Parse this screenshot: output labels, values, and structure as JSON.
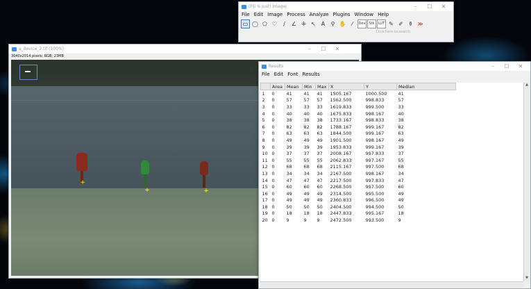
{
  "imagej_window": {
    "title": "(Fiji Is Just) ImageJ",
    "menu": [
      "File",
      "Edit",
      "Image",
      "Process",
      "Analyze",
      "Plugins",
      "Window",
      "Help"
    ],
    "tools": [
      {
        "name": "rectangle-tool-icon",
        "glyph": "▭",
        "active": true
      },
      {
        "name": "oval-tool-icon",
        "glyph": "◯"
      },
      {
        "name": "polygon-tool-icon",
        "glyph": "⬠"
      },
      {
        "name": "freehand-tool-icon",
        "glyph": "♡"
      },
      {
        "name": "line-tool-icon",
        "glyph": "∕"
      },
      {
        "name": "angle-tool-icon",
        "glyph": "∠"
      },
      {
        "name": "point-tool-icon",
        "glyph": "⁜"
      },
      {
        "name": "wand-tool-icon",
        "glyph": "↖"
      },
      {
        "name": "text-tool-icon",
        "glyph": "A"
      },
      {
        "name": "magnifier-tool-icon",
        "glyph": "⚲"
      },
      {
        "name": "hand-tool-icon",
        "glyph": "✋"
      },
      {
        "name": "dropper-tool-icon",
        "glyph": "⁄"
      },
      {
        "name": "dev-tool-icon",
        "glyph": "Dev",
        "box": true
      },
      {
        "name": "stk-tool-icon",
        "glyph": "Stk",
        "box": true
      },
      {
        "name": "lut-tool-icon",
        "glyph": "LUT",
        "box": true
      },
      {
        "name": "brush-tool-icon",
        "glyph": "✎"
      },
      {
        "name": "pencil-tool-icon",
        "glyph": "✐"
      },
      {
        "name": "flood-fill-tool-icon",
        "glyph": "⚱"
      },
      {
        "name": "more-tools-icon",
        "glyph": "≫",
        "color": "#d02020"
      }
    ],
    "status": "Click here to search"
  },
  "image_window": {
    "title": "a_device_2.tif (100%)",
    "info": "3040x2014 pixels; RGB; 23MB"
  },
  "results_window": {
    "title": "Results",
    "menu": [
      "File",
      "Edit",
      "Font",
      "Results"
    ],
    "columns": [
      "",
      "Area",
      "Mean",
      "Min",
      "Max",
      "X",
      "Y",
      "Median"
    ],
    "rows": [
      [
        "1",
        "0",
        "41",
        "41",
        "41",
        "1505.167",
        "1000.500",
        "41"
      ],
      [
        "2",
        "0",
        "57",
        "57",
        "57",
        "1562.500",
        "998.833",
        "57"
      ],
      [
        "3",
        "0",
        "33",
        "33",
        "33",
        "1619.833",
        "999.500",
        "33"
      ],
      [
        "4",
        "0",
        "40",
        "40",
        "40",
        "1675.833",
        "998.167",
        "40"
      ],
      [
        "5",
        "0",
        "38",
        "38",
        "38",
        "1733.167",
        "998.833",
        "38"
      ],
      [
        "6",
        "0",
        "82",
        "82",
        "82",
        "1788.167",
        "999.167",
        "82"
      ],
      [
        "7",
        "0",
        "63",
        "63",
        "63",
        "1844.500",
        "999.167",
        "63"
      ],
      [
        "8",
        "0",
        "49",
        "49",
        "49",
        "1901.500",
        "998.167",
        "49"
      ],
      [
        "9",
        "0",
        "39",
        "39",
        "39",
        "1953.833",
        "999.167",
        "39"
      ],
      [
        "10",
        "0",
        "37",
        "37",
        "37",
        "2008.167",
        "997.833",
        "37"
      ],
      [
        "11",
        "0",
        "55",
        "55",
        "55",
        "2062.833",
        "997.167",
        "55"
      ],
      [
        "12",
        "0",
        "68",
        "68",
        "68",
        "2115.167",
        "997.500",
        "68"
      ],
      [
        "13",
        "0",
        "34",
        "34",
        "34",
        "2167.500",
        "998.167",
        "34"
      ],
      [
        "14",
        "0",
        "47",
        "47",
        "47",
        "2217.500",
        "997.833",
        "47"
      ],
      [
        "15",
        "0",
        "60",
        "60",
        "60",
        "2268.500",
        "997.500",
        "60"
      ],
      [
        "16",
        "0",
        "49",
        "49",
        "49",
        "2314.500",
        "995.500",
        "49"
      ],
      [
        "17",
        "0",
        "49",
        "49",
        "49",
        "2360.833",
        "996.500",
        "49"
      ],
      [
        "18",
        "0",
        "50",
        "50",
        "50",
        "2404.500",
        "994.500",
        "50"
      ],
      [
        "19",
        "0",
        "18",
        "18",
        "18",
        "2447.833",
        "995.167",
        "18"
      ],
      [
        "20",
        "0",
        "9",
        "9",
        "9",
        "2472.500",
        "993.500",
        "9"
      ]
    ]
  },
  "colors": {
    "pin_red": "#8b2a1c",
    "pin_green": "#2f8a3a",
    "accent": "#3a8ee6"
  }
}
